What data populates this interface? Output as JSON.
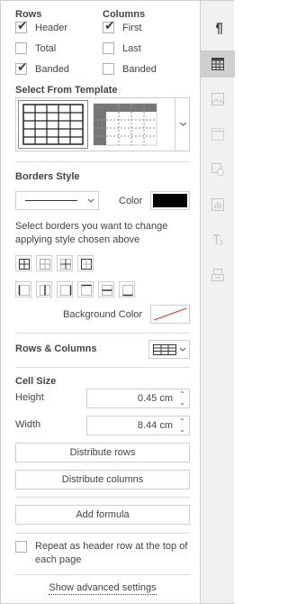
{
  "rows_section": {
    "title": "Rows",
    "options": [
      {
        "label": "Header",
        "checked": true
      },
      {
        "label": "Total",
        "checked": false
      },
      {
        "label": "Banded",
        "checked": true
      }
    ]
  },
  "columns_section": {
    "title": "Columns",
    "options": [
      {
        "label": "First",
        "checked": true
      },
      {
        "label": "Last",
        "checked": false
      },
      {
        "label": "Banded",
        "checked": false
      }
    ]
  },
  "template": {
    "title": "Select From Template"
  },
  "borders": {
    "title": "Borders Style",
    "color_label": "Color",
    "border_color": "#000000",
    "hint": "Select borders you want to change applying style chosen above",
    "background_label": "Background Color"
  },
  "rows_columns": {
    "title": "Rows & Columns"
  },
  "cell_size": {
    "title": "Cell Size",
    "height_label": "Height",
    "height_value": "0.45 cm",
    "width_label": "Width",
    "width_value": "8.44 cm"
  },
  "buttons": {
    "distribute_rows": "Distribute rows",
    "distribute_columns": "Distribute columns",
    "add_formula": "Add formula"
  },
  "repeat_header": {
    "label": "Repeat as header row at the top of each page",
    "checked": false
  },
  "advanced": {
    "label": "Show advanced settings"
  },
  "colors": {
    "accent_active_tab": "#cfcfcf",
    "rail_bg": "#f1f1f1",
    "border": "#cfcfcf"
  },
  "rail_icons": [
    "paragraph-icon",
    "table-icon",
    "image-icon",
    "header-footer-icon",
    "shape-icon",
    "chart-icon",
    "text-art-icon",
    "mail-merge-icon"
  ]
}
